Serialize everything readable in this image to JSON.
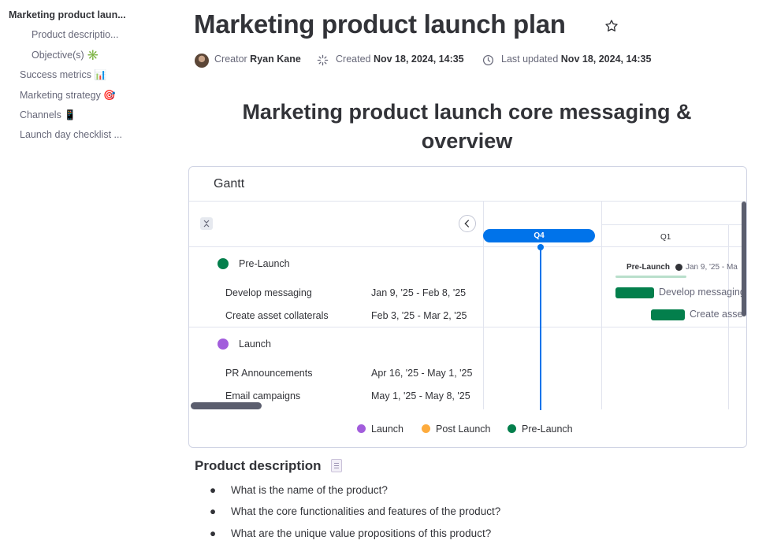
{
  "toc": {
    "items": [
      {
        "label": "Marketing product laun...",
        "active": true
      },
      {
        "label": "Product descriptio..."
      },
      {
        "label": "Objective(s) ✳️"
      },
      {
        "label": "Success metrics 📊"
      },
      {
        "label": "Marketing strategy 🎯"
      },
      {
        "label": "Channels 📱"
      },
      {
        "label": "Launch day checklist ..."
      }
    ]
  },
  "doc": {
    "title": "Marketing product launch plan",
    "creator_label": "Creator",
    "creator_name": "Ryan Kane",
    "created_label": "Created",
    "created_value": "Nov 18, 2024, 14:35",
    "updated_label": "Last updated",
    "updated_value": "Nov 18, 2024, 14:35"
  },
  "section": {
    "heading_line1": "Marketing product launch core messaging &",
    "heading_line2": "overview"
  },
  "gantt": {
    "title": "Gantt",
    "timeline": {
      "current_quarter": "Q4",
      "next_quarter": "Q1"
    },
    "groups": [
      {
        "name": "Pre-Launch",
        "color": "#037f4c",
        "summary_label": "Pre-Launch",
        "summary_date": "Jan 9, '25 - Ma",
        "rows": [
          {
            "name": "Develop messaging",
            "dates": "Jan 9, '25 - Feb 8, '25",
            "bar_label": "Develop messaging"
          },
          {
            "name": "Create asset collaterals",
            "dates": "Feb 3, '25 - Mar 2, '25",
            "bar_label": "Create asse"
          }
        ]
      },
      {
        "name": "Launch",
        "color": "#a25ddc",
        "rows": [
          {
            "name": "PR Announcements",
            "dates": "Apr 16, '25 - May 1, '25"
          },
          {
            "name": "Email campaigns",
            "dates": "May 1, '25 - May 8, '25"
          }
        ]
      }
    ],
    "legend": [
      {
        "label": "Launch",
        "color": "#a25ddc"
      },
      {
        "label": "Post Launch",
        "color": "#fdab3d"
      },
      {
        "label": "Pre-Launch",
        "color": "#037f4c"
      }
    ]
  },
  "product_description": {
    "heading": "Product description",
    "bullets": [
      "What is the name of the product?",
      "What the core functionalities and features of the product?",
      "What are the unique value propositions of this product?"
    ]
  },
  "colors": {
    "accent": "#0073ea",
    "text": "#323338",
    "muted": "#676879"
  },
  "icons": [
    "star-icon",
    "avatar",
    "sparkle-icon",
    "clock-icon",
    "collapse-icon",
    "chevron-left-icon",
    "doc-icon"
  ]
}
